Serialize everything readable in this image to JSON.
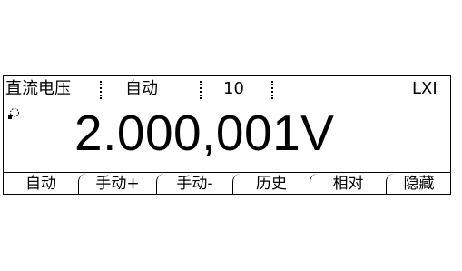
{
  "status_bar": {
    "function": "直流电压",
    "range_mode": "自动",
    "rate": "10",
    "interface": "LXI"
  },
  "display": {
    "reading": "2.000,001V",
    "trigger_icon": "auto-trigger-icon"
  },
  "softkeys": [
    {
      "label": "自动"
    },
    {
      "label": "手动+"
    },
    {
      "label": "手动-"
    },
    {
      "label": "历史"
    },
    {
      "label": "相对"
    },
    {
      "label": "隐藏"
    }
  ]
}
